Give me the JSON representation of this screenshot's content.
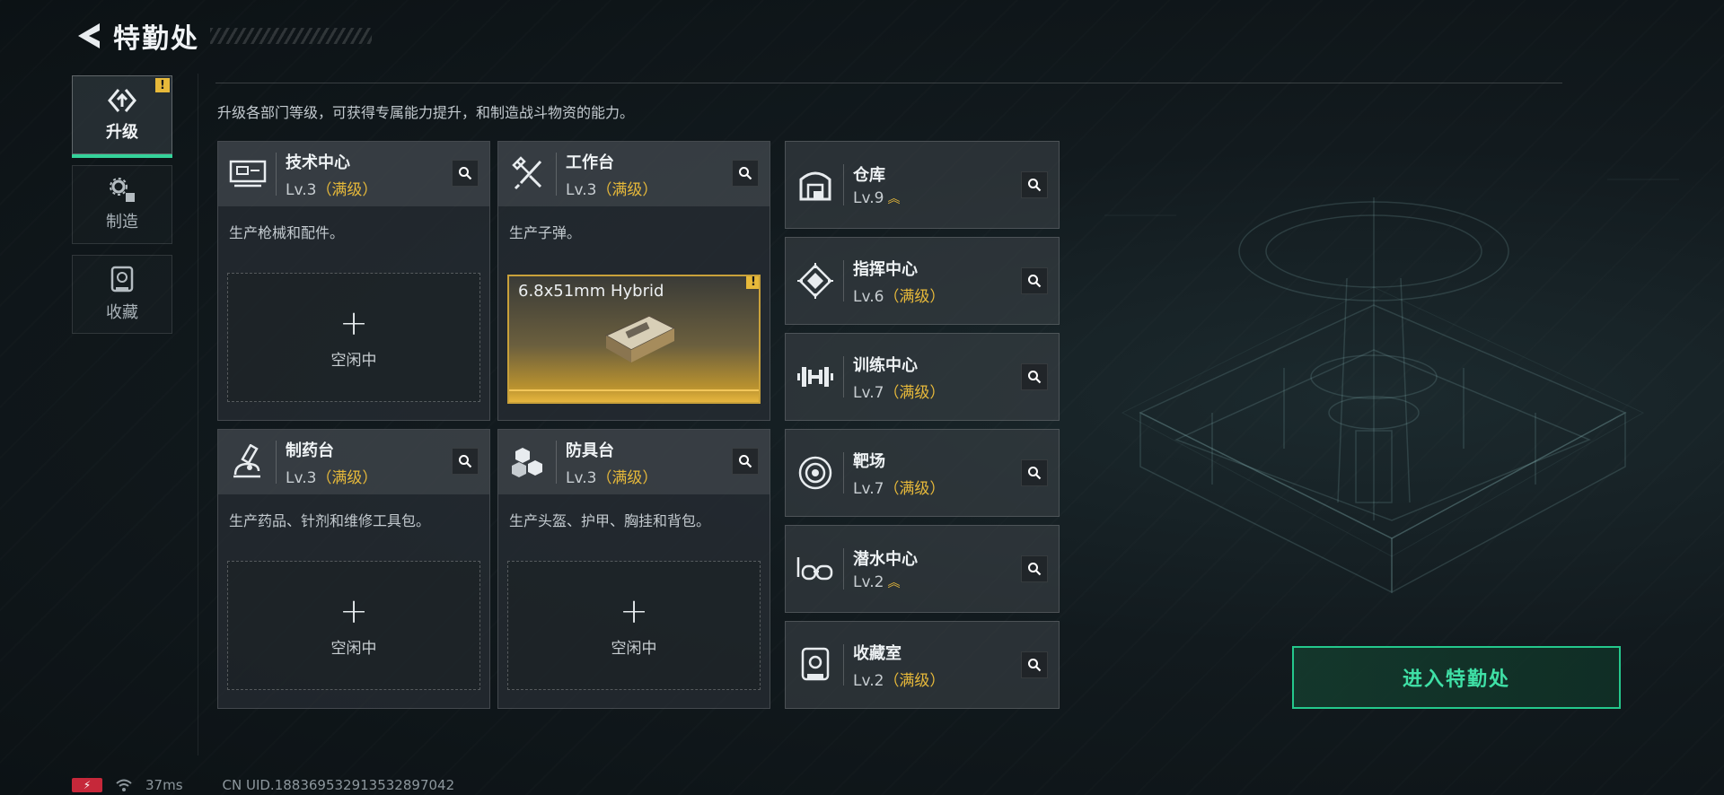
{
  "header": {
    "title": "特勤处"
  },
  "nav": [
    {
      "label": "升级",
      "active": true,
      "badge": "!"
    },
    {
      "label": "制造",
      "active": false
    },
    {
      "label": "收藏",
      "active": false
    }
  ],
  "description": "升级各部门等级，可获得专属能力提升，和制造战斗物资的能力。",
  "cards": [
    {
      "name": "技术中心",
      "level": "Lv.3",
      "max_label": "（满级）",
      "desc": "生产枪械和配件。",
      "slot_plus": "+",
      "slot_status": "空闲中",
      "icon": "tech-center-icon"
    },
    {
      "name": "工作台",
      "level": "Lv.3",
      "max_label": "（满级）",
      "desc": "生产子弹。",
      "crafting_item": "6.8x51mm Hybrid",
      "badge": "!",
      "icon": "workbench-icon"
    },
    {
      "name": "制药台",
      "level": "Lv.3",
      "max_label": "（满级）",
      "desc": "生产药品、针剂和维修工具包。",
      "slot_plus": "+",
      "slot_status": "空闲中",
      "icon": "pharmacy-icon"
    },
    {
      "name": "防具台",
      "level": "Lv.3",
      "max_label": "（满级）",
      "desc": "生产头盔、护甲、胸挂和背包。",
      "slot_plus": "+",
      "slot_status": "空闲中",
      "icon": "armor-bench-icon"
    }
  ],
  "facilities": [
    {
      "name": "仓库",
      "level": "Lv.9",
      "max_label": "",
      "upgradable": true,
      "icon": "warehouse-icon"
    },
    {
      "name": "指挥中心",
      "level": "Lv.6",
      "max_label": "（满级）",
      "upgradable": false,
      "icon": "command-center-icon"
    },
    {
      "name": "训练中心",
      "level": "Lv.7",
      "max_label": "（满级）",
      "upgradable": false,
      "icon": "dumbbell-icon"
    },
    {
      "name": "靶场",
      "level": "Lv.7",
      "max_label": "（满级）",
      "upgradable": false,
      "icon": "target-icon"
    },
    {
      "name": "潜水中心",
      "level": "Lv.2",
      "max_label": "",
      "upgradable": true,
      "icon": "diving-mask-icon"
    },
    {
      "name": "收藏室",
      "level": "Lv.2",
      "max_label": "（满级）",
      "upgradable": false,
      "icon": "collection-room-icon"
    }
  ],
  "enter_button": "进入特勤处",
  "status_bar": {
    "ping": "37ms",
    "uid": "CN UID.18836953291353289704​2"
  },
  "colors": {
    "accent_green": "#24c88c",
    "max_gold": "#e7b93a",
    "alert": "#e7b93a"
  }
}
